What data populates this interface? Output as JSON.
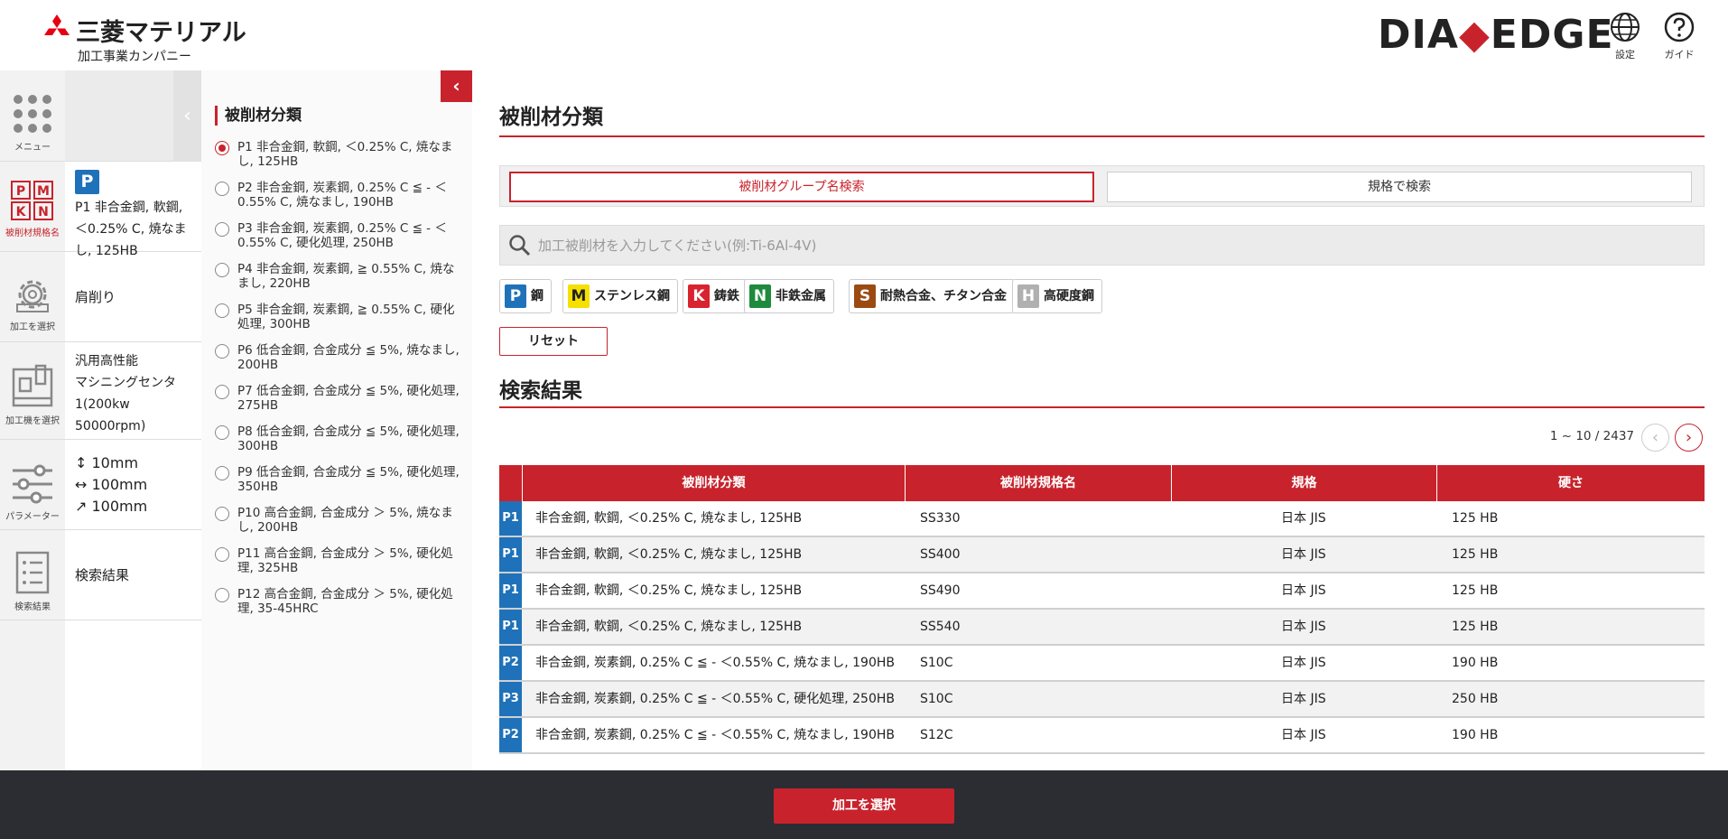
{
  "header": {
    "company_name": "三菱マテリアル",
    "company_sub": "加工事業カンパニー",
    "brand_left": "DIA",
    "brand_right": "EDGE",
    "settings_label": "設定",
    "guide_label": "ガイド"
  },
  "rail": {
    "menu_label": "メニュー",
    "material_label": "被削材規格名",
    "process_label": "加工を選択",
    "machine_label": "加工機を選択",
    "params_label": "パラメーター",
    "results_label": "検索結果"
  },
  "summary": {
    "material_badge": "P",
    "material_text": "P1 非合金鋼, 軟鋼, ＜0.25% C, 焼なまし, 125HB",
    "process_text": "肩削り",
    "machine_lines": [
      "汎用高性能",
      "マシニングセンタ",
      "1(200kw",
      "50000rpm)"
    ],
    "params": [
      "↕ 10mm",
      "↔ 100mm",
      "↗ 100mm"
    ],
    "results_text": "検索結果"
  },
  "panel": {
    "title": "被削材分類",
    "options": [
      {
        "label": "P1 非合金鋼, 軟鋼, ＜0.25% C, 焼なまし, 125HB",
        "selected": true
      },
      {
        "label": "P2 非合金鋼, 炭素鋼, 0.25% C ≦ - ＜ 0.55% C, 焼なまし, 190HB",
        "selected": false
      },
      {
        "label": "P3 非合金鋼, 炭素鋼, 0.25% C ≦ - ＜ 0.55% C, 硬化処理, 250HB",
        "selected": false
      },
      {
        "label": "P4 非合金鋼, 炭素鋼, ≧ 0.55% C, 焼なまし, 220HB",
        "selected": false
      },
      {
        "label": "P5 非合金鋼, 炭素鋼, ≧ 0.55% C, 硬化処理, 300HB",
        "selected": false
      },
      {
        "label": "P6 低合金鋼, 合金成分 ≦ 5%, 焼なまし, 200HB",
        "selected": false
      },
      {
        "label": "P7 低合金鋼, 合金成分 ≦ 5%, 硬化処理, 275HB",
        "selected": false
      },
      {
        "label": "P8 低合金鋼, 合金成分 ≦ 5%, 硬化処理, 300HB",
        "selected": false
      },
      {
        "label": "P9 低合金鋼, 合金成分 ≦ 5%, 硬化処理, 350HB",
        "selected": false
      },
      {
        "label": "P10 高合金鋼, 合金成分 ＞ 5%, 焼なまし, 200HB",
        "selected": false
      },
      {
        "label": "P11 高合金鋼, 合金成分 ＞ 5%, 硬化処理, 325HB",
        "selected": false
      },
      {
        "label": "P12 高合金鋼, 合金成分 ＞ 5%, 硬化処理, 35-45HRC",
        "selected": false
      }
    ]
  },
  "main": {
    "title": "被削材分類",
    "tab_group": "被削材グループ名検索",
    "tab_standard": "規格で検索",
    "search_placeholder": "加工被削材を入力してください(例:Ti-6Al-4V)",
    "chips": [
      {
        "letter": "P",
        "label": "鋼",
        "color": "#1f72b9",
        "text_color": "#ffffff"
      },
      {
        "letter": "M",
        "label": "ステンレス鋼",
        "color": "#f5e000",
        "text_color": "#222222"
      },
      {
        "letter": "K",
        "label": "鋳鉄",
        "color": "#d9232e",
        "text_color": "#ffffff"
      },
      {
        "letter": "N",
        "label": "非鉄金属",
        "color": "#1e8a3c",
        "text_color": "#ffffff"
      },
      {
        "letter": "S",
        "label": "耐熱合金、チタン合金",
        "color": "#9b4a12",
        "text_color": "#ffffff"
      },
      {
        "letter": "H",
        "label": "高硬度鋼",
        "color": "#b0b0b0",
        "text_color": "#ffffff"
      }
    ],
    "reset_label": "リセット",
    "results_title": "検索結果",
    "pager_text": "1 ~ 10 / 2437",
    "table": {
      "headers": [
        "被削材分類",
        "被削材規格名",
        "規格",
        "硬さ"
      ],
      "rows": [
        {
          "code": "P1",
          "classification": "非合金鋼, 軟鋼, ＜0.25% C, 焼なまし, 125HB",
          "name": "SS330",
          "standard": "日本 JIS",
          "hardness": "125 HB"
        },
        {
          "code": "P1",
          "classification": "非合金鋼, 軟鋼, ＜0.25% C, 焼なまし, 125HB",
          "name": "SS400",
          "standard": "日本 JIS",
          "hardness": "125 HB"
        },
        {
          "code": "P1",
          "classification": "非合金鋼, 軟鋼, ＜0.25% C, 焼なまし, 125HB",
          "name": "SS490",
          "standard": "日本 JIS",
          "hardness": "125 HB"
        },
        {
          "code": "P1",
          "classification": "非合金鋼, 軟鋼, ＜0.25% C, 焼なまし, 125HB",
          "name": "SS540",
          "standard": "日本 JIS",
          "hardness": "125 HB"
        },
        {
          "code": "P2",
          "classification": "非合金鋼, 炭素鋼, 0.25% C ≦ - ＜0.55% C, 焼なまし, 190HB",
          "name": "S10C",
          "standard": "日本 JIS",
          "hardness": "190 HB"
        },
        {
          "code": "P3",
          "classification": "非合金鋼, 炭素鋼, 0.25% C ≦ - ＜0.55% C, 硬化処理, 250HB",
          "name": "S10C",
          "standard": "日本 JIS",
          "hardness": "250 HB"
        },
        {
          "code": "P2",
          "classification": "非合金鋼, 炭素鋼, 0.25% C ≦ - ＜0.55% C, 焼なまし, 190HB",
          "name": "S12C",
          "standard": "日本 JIS",
          "hardness": "190 HB"
        }
      ]
    }
  },
  "footer": {
    "select_process_label": "加工を選択"
  }
}
